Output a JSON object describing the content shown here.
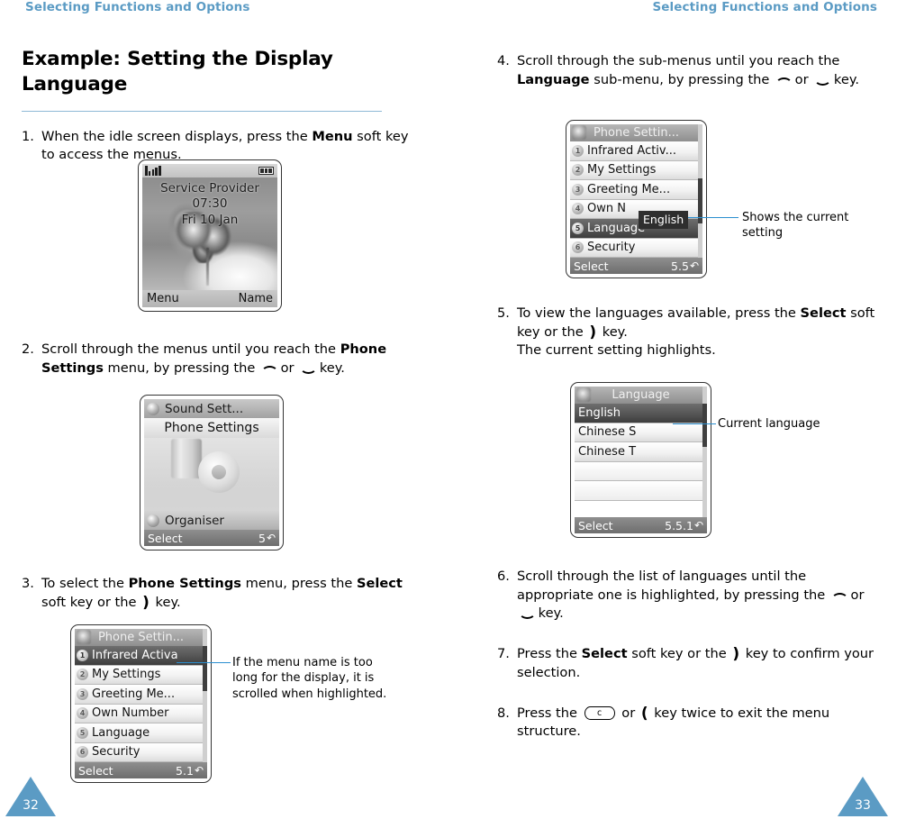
{
  "header": {
    "left_title": "Selecting Functions and Options",
    "right_title": "Selecting Functions and Options"
  },
  "left_page": {
    "number": "32",
    "title": "Example: Setting the Display Language",
    "steps": [
      {
        "num": "1.",
        "parts": [
          {
            "t": "When the idle screen displays, press the "
          },
          {
            "t": "Menu",
            "b": true
          },
          {
            "t": " soft key to access the menus."
          }
        ]
      },
      {
        "num": "2.",
        "parts": [
          {
            "t": "Scroll through the menus until you reach the "
          },
          {
            "t": "Phone Settings",
            "b": true
          },
          {
            "t": " menu, by pressing the "
          },
          {
            "t": "",
            "key": "up"
          },
          {
            "t": " or "
          },
          {
            "t": "",
            "key": "down"
          },
          {
            "t": " key."
          }
        ]
      },
      {
        "num": "3.",
        "parts": [
          {
            "t": "To select the "
          },
          {
            "t": "Phone Settings",
            "b": true
          },
          {
            "t": " menu, press the "
          },
          {
            "t": "Select",
            "b": true
          },
          {
            "t": " soft key or the "
          },
          {
            "t": "",
            "key": "right"
          },
          {
            "t": " key."
          }
        ]
      }
    ],
    "callout_menu_name": "If the menu name is too long for the display, it is scrolled when highlighted."
  },
  "right_page": {
    "number": "33",
    "steps": [
      {
        "num": "4.",
        "parts": [
          {
            "t": "Scroll through the sub-menus until you reach the "
          },
          {
            "t": "Language",
            "b": true
          },
          {
            "t": " sub-menu, by pressing the "
          },
          {
            "t": "",
            "key": "up"
          },
          {
            "t": " or "
          },
          {
            "t": "",
            "key": "down"
          },
          {
            "t": " key."
          }
        ]
      },
      {
        "num": "5.",
        "parts": [
          {
            "t": "To view the languages available, press the "
          },
          {
            "t": "Select",
            "b": true
          },
          {
            "t": " soft key or the "
          },
          {
            "t": "",
            "key": "right"
          },
          {
            "t": " key."
          },
          {
            "t": "",
            "br": true
          },
          {
            "t": "The current setting highlights."
          }
        ]
      },
      {
        "num": "6.",
        "parts": [
          {
            "t": "Scroll through the list of languages until the appropriate one is highlighted, by pressing the "
          },
          {
            "t": "",
            "key": "up"
          },
          {
            "t": " or "
          },
          {
            "t": "",
            "key": "down"
          },
          {
            "t": " key."
          }
        ]
      },
      {
        "num": "7.",
        "parts": [
          {
            "t": "Press the "
          },
          {
            "t": "Select",
            "b": true
          },
          {
            "t": " soft key or the "
          },
          {
            "t": "",
            "key": "right"
          },
          {
            "t": " key to confirm your selection."
          }
        ]
      },
      {
        "num": "8.",
        "parts": [
          {
            "t": "Press the "
          },
          {
            "t": "",
            "key": "clear"
          },
          {
            "t": " or "
          },
          {
            "t": "",
            "key": "left"
          },
          {
            "t": " key twice to exit the menu structure."
          }
        ]
      }
    ],
    "callout_current_setting": "Shows the current setting",
    "callout_current_language": "Current language"
  },
  "figures": {
    "idle_screen": {
      "provider": "Service Provider",
      "time": "07:30",
      "date": "Fri 10 Jan",
      "softkey_left": "Menu",
      "softkey_right": "Name"
    },
    "phone_settings_carousel": {
      "item_above": "Sound Sett...",
      "item_current": "Phone Settings",
      "item_below": "Organiser",
      "softkey_left": "Select",
      "menu_number": "5"
    },
    "phone_settings_list_1": {
      "title": "Phone Settin...",
      "items": [
        {
          "badge": "1",
          "label": "Infrared Activa",
          "selected": true
        },
        {
          "badge": "2",
          "label": "My Settings",
          "selected": false
        },
        {
          "badge": "3",
          "label": "Greeting Me...",
          "selected": false
        },
        {
          "badge": "4",
          "label": "Own Number",
          "selected": false
        },
        {
          "badge": "5",
          "label": "Language",
          "selected": false
        },
        {
          "badge": "6",
          "label": "Security",
          "selected": false
        }
      ],
      "softkey_left": "Select",
      "menu_number": "5.1"
    },
    "phone_settings_list_2": {
      "title": "Phone Settin...",
      "items": [
        {
          "badge": "1",
          "label": "Infrared Activ...",
          "selected": false
        },
        {
          "badge": "2",
          "label": "My Settings",
          "selected": false
        },
        {
          "badge": "3",
          "label": "Greeting Me...",
          "selected": false
        },
        {
          "badge": "4",
          "label": "Own N",
          "selected": false
        },
        {
          "badge": "5",
          "label": "Language",
          "selected": true
        },
        {
          "badge": "6",
          "label": "Security",
          "selected": false
        }
      ],
      "tooltip": "English",
      "softkey_left": "Select",
      "menu_number": "5.5"
    },
    "language_list": {
      "title": "Language",
      "items": [
        {
          "label": "English",
          "selected": true
        },
        {
          "label": "Chinese S",
          "selected": false
        },
        {
          "label": "Chinese T",
          "selected": false
        }
      ],
      "softkey_left": "Select",
      "menu_number": "5.5.1"
    }
  },
  "colors": {
    "accent_blue": "#5b9bc4",
    "callout_blue": "#2b8fd0"
  }
}
